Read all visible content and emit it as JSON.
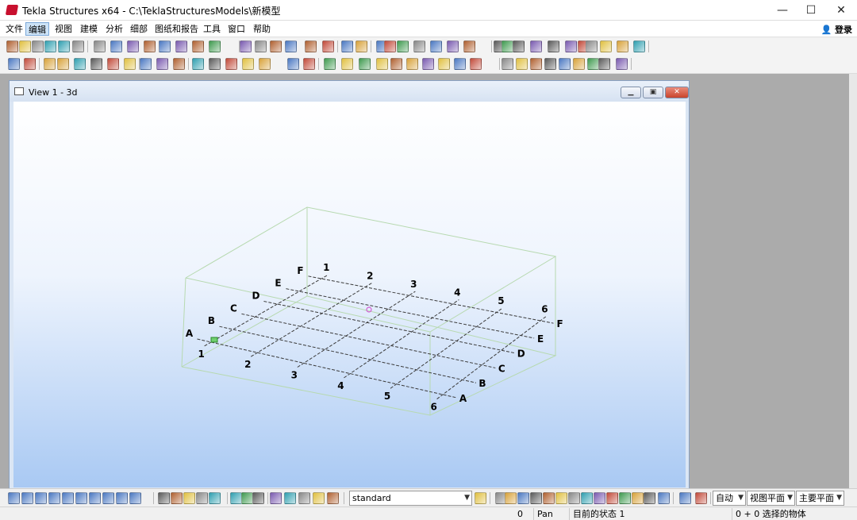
{
  "window": {
    "title": "Tekla Structures x64 - C:\\TeklaStructuresModels\\新模型",
    "minimize": "—",
    "maximize": "☐",
    "close": "✕"
  },
  "menubar": {
    "items": [
      "文件",
      "编辑",
      "视图",
      "建模",
      "分析",
      "细部",
      "图纸和报告",
      "工具",
      "窗口",
      "帮助"
    ],
    "active": "编辑",
    "login_label": "登录"
  },
  "view": {
    "title": "View 1 - 3d",
    "grid_letters": [
      "A",
      "B",
      "C",
      "D",
      "E",
      "F"
    ],
    "grid_numbers": [
      "1",
      "2",
      "3",
      "4",
      "5",
      "6"
    ]
  },
  "bottom_toolbar": {
    "standard_select": "standard",
    "snap_mode_select": "自动",
    "view_plane_select": "视图平面",
    "main_plane_select": "主要平面"
  },
  "statusbar": {
    "count": "0",
    "mode": "Pan",
    "current_state": "目前的状态 1",
    "selection": "0 + 0 选择的物体"
  },
  "colors": {
    "gridline": "#3a3a3a",
    "bounding_box": "#b7d9b0",
    "accent": "#2f6fb7"
  }
}
